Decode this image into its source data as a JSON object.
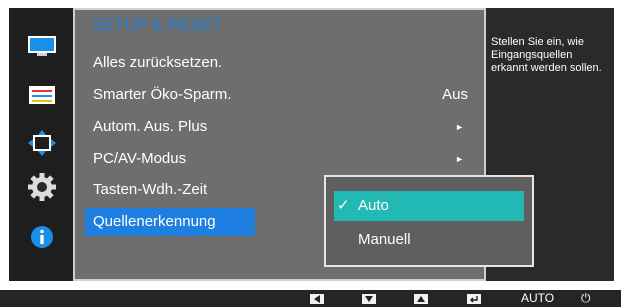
{
  "menu": {
    "title": "SETUP & RESET",
    "items": [
      {
        "label": "Alles zurücksetzen.",
        "value": "",
        "has_submenu": false
      },
      {
        "label": "Smarter Öko-Sparm.",
        "value": "Aus",
        "has_submenu": false
      },
      {
        "label": "Autom. Aus. Plus",
        "value": "",
        "has_submenu": true
      },
      {
        "label": "PC/AV-Modus",
        "value": "",
        "has_submenu": true
      },
      {
        "label": "Tasten-Wdh.-Zeit",
        "value": "",
        "has_submenu": false
      },
      {
        "label": "Quellenerkennung",
        "value": "",
        "has_submenu": false
      }
    ],
    "selected_index": 5,
    "submenu_arrow": "►"
  },
  "submenu": {
    "options": [
      {
        "label": "Auto",
        "checked": true
      },
      {
        "label": "Manuell",
        "checked": false
      }
    ],
    "check_glyph": "✓"
  },
  "help": {
    "text": "Stellen Sie ein, wie Eingangsquellen erkannt werden sollen."
  },
  "rail_icons": [
    "picture-icon",
    "screen-adjust-icon",
    "position-icon",
    "settings-gear-icon",
    "information-icon"
  ],
  "bottom_bar": {
    "auto_label": "AUTO",
    "power_glyph": "⏻",
    "keys": [
      "left-arrow-key-icon",
      "down-arrow-key-icon",
      "up-arrow-key-icon",
      "enter-key-icon"
    ]
  },
  "colors": {
    "accent_blue": "#1f7fe0",
    "highlight_teal": "#22b8b4",
    "panel_gray": "#6e6e6e"
  }
}
